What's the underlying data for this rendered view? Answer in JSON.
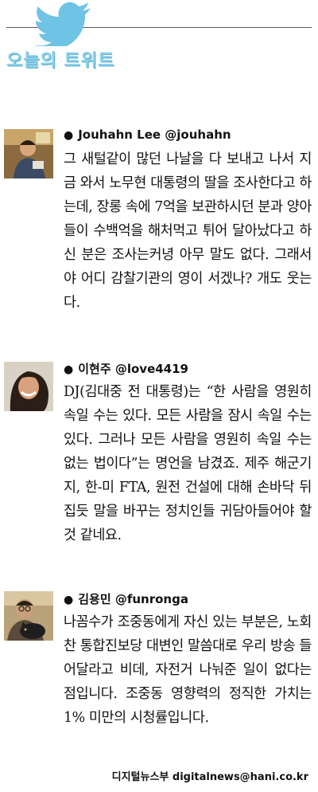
{
  "header": {
    "title": "오늘의 트위트"
  },
  "entries": [
    {
      "author": "Jouhahn Lee @jouhahn",
      "text": "그 새털같이 많던 나날을 다 보내고 나서 지금 와서 노무현 대통령의 딸을 조사한다고 하는데, 장롱 속에 7억을 보관하시던 분과 양아들이 수백억을 해처먹고 튀어 달아났다고 하신 분은 조사는커녕 아무 말도 없다. 그래서야 어디 감찰기관의 영이 서겠나? 개도 웃는다."
    },
    {
      "author": "이현주 @love4419",
      "text": "DJ(김대중 전 대통령)는 “한 사람을 영원히 속일 수는 있다. 모든 사람을 잠시 속일 수는 있다. 그러나 모든 사람을 영원히 속일 수는 없는 법이다”는 명언을 남겼죠. 제주 해군기지, 한-미 FTA, 원전 건설에 대해 손바닥 뒤집듯 말을 바꾸는 정치인들 귀담아들어야 할 것 같네요."
    },
    {
      "author": "김용민 @funronga",
      "text": "나꼼수가 조중동에게 자신 있는 부분은, 노회찬 통합진보당 대변인 말씀대로 우리 방송 들어달라고 비데, 자전거 나눠준 일이 없다는 점입니다. 조중동 영향력의 정직한 가치는 1% 미만의 시청률입니다."
    }
  ],
  "credit": "디지털뉴스부 digitalnews@hani.co.kr",
  "colors": {
    "title": "#8fd0ea",
    "bird": "#6fc3e4",
    "rule": "#5a5a5a"
  }
}
